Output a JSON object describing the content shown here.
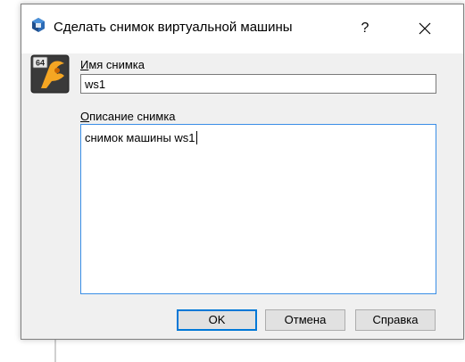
{
  "window": {
    "title": "Сделать снимок виртуальной машины",
    "help_glyph": "?",
    "app_icon": "virtualbox-logo-icon",
    "os_icon": "os-type-64bit-icon"
  },
  "form": {
    "name_label_mnemonic": "И",
    "name_label_rest": "мя снимка",
    "name_value": "ws1",
    "description_label_mnemonic": "О",
    "description_label_rest": "писание снимка",
    "description_value": "снимок машины ws1",
    "os_badge": "64"
  },
  "buttons": {
    "ok": "OK",
    "cancel": "Отмена",
    "help": "Справка"
  },
  "colors": {
    "focus_border": "#3a8ee6",
    "default_button_border": "#0078d7",
    "icon_orange": "#f5a623"
  }
}
